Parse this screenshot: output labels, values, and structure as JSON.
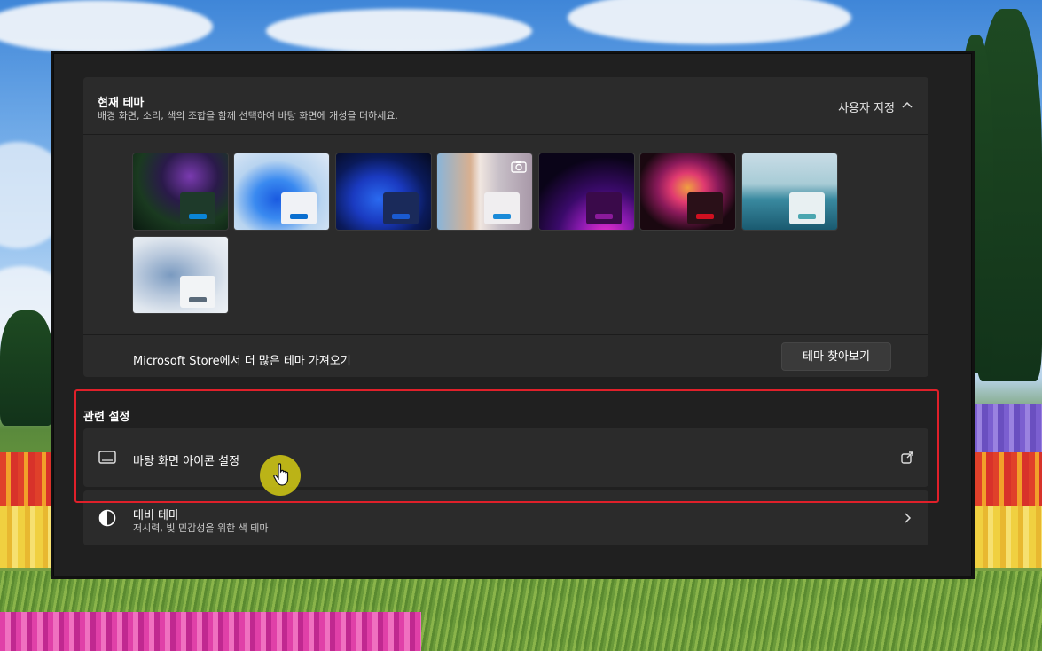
{
  "current_theme": {
    "title": "현재 테마",
    "description": "배경 화면, 소리, 색의 조합을 함께 선택하여 바탕 화면에 개성을 더하세요.",
    "status": "사용자 지정",
    "themes": [
      {
        "name": "theme-thumb-1",
        "accent": "#0a84d6"
      },
      {
        "name": "theme-thumb-2",
        "accent": "#0a6fd0"
      },
      {
        "name": "theme-thumb-3",
        "accent": "#1a5ad0"
      },
      {
        "name": "theme-thumb-4",
        "accent": "#1a8ad8"
      },
      {
        "name": "theme-thumb-5",
        "accent": "#8a1a9a"
      },
      {
        "name": "theme-thumb-6",
        "accent": "#d01020"
      },
      {
        "name": "theme-thumb-7",
        "accent": "#4aa6b0"
      },
      {
        "name": "theme-thumb-8",
        "accent": "#5a6a7a"
      }
    ]
  },
  "store": {
    "text": "Microsoft Store에서 더 많은 테마 가져오기",
    "button": "테마 찾아보기"
  },
  "related": {
    "title": "관련 설정",
    "desktop_icons": {
      "label": "바탕 화면 아이콘 설정"
    },
    "contrast": {
      "label": "대비 테마",
      "sub": "저시력, 빛 민감성을 위한 색 테마"
    }
  },
  "colors": {
    "highlight": "#e0202a",
    "cursor_halo": "#dcd214"
  }
}
